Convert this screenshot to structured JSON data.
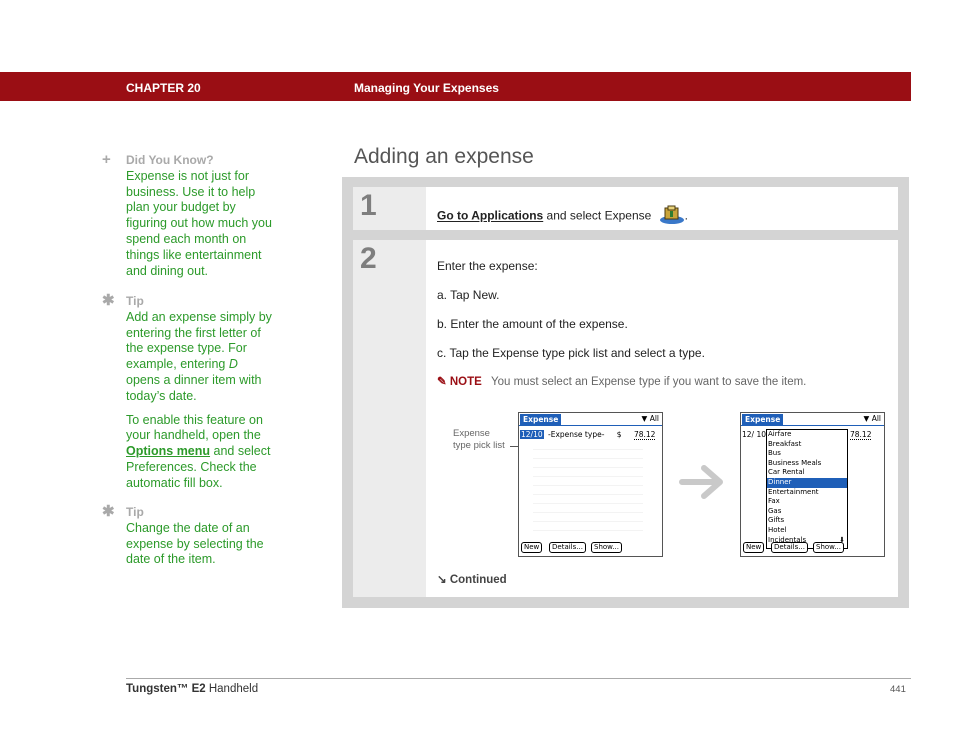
{
  "header": {
    "chapter": "CHAPTER 20",
    "title": "Managing Your Expenses"
  },
  "sidebar": {
    "did_you_know": {
      "heading": "Did You Know?",
      "body": "Expense is not just for business. Use it to help plan your budget by figuring out how much you spend each month on things like entertainment and dining out."
    },
    "tip1": {
      "heading": "Tip",
      "body_a": "Add an expense simply by entering the first letter of the expense type. For example, entering ",
      "body_em": "D",
      "body_b": " opens a dinner item with today’s date.",
      "body2_a": "To enable this feature on your handheld, open the ",
      "body2_link": "Options menu",
      "body2_b": " and select Preferences. Check the automatic fill box."
    },
    "tip2": {
      "heading": "Tip",
      "body": "Change the date of an expense by selecting the date of the item."
    }
  },
  "main": {
    "heading": "Adding an expense",
    "step1": {
      "number": "1",
      "link": "Go to Applications",
      "text": " and select Expense",
      "end": "."
    },
    "step2": {
      "number": "2",
      "intro": "Enter the expense:",
      "a": "a.  Tap New.",
      "b": "b.  Enter the amount of the expense.",
      "c": "c.  Tap the Expense type pick list and select a type.",
      "note_label": "NOTE",
      "note_text": "You must select an Expense type if you want to save the item.",
      "callout_line1": "Expense",
      "callout_line2": "type pick list",
      "continued": "Continued"
    },
    "screen1": {
      "title": "Expense",
      "filter": "All",
      "date": "12/10",
      "type": "-Expense type-",
      "currency": "$",
      "amount": "78.12",
      "btn_new": "New",
      "btn_details": "Details...",
      "btn_show": "Show..."
    },
    "screen2": {
      "title": "Expense",
      "filter": "All",
      "date": "12/ 10",
      "amount": "78.12",
      "btn_new": "New",
      "btn_details": "Details...",
      "btn_show": "Show...",
      "list": [
        "Airfare",
        "Breakfast",
        "Bus",
        "Business Meals",
        "Car Rental",
        "Dinner",
        "Entertainment",
        "Fax",
        "Gas",
        "Gifts",
        "Hotel",
        "Incidentals"
      ],
      "selected": "Dinner"
    }
  },
  "footer": {
    "product_a": "Tungsten™ E2",
    "product_b": " Handheld",
    "page": "441"
  },
  "colors": {
    "bar": "#9a0e14",
    "sidebar_text": "#2c9a2a",
    "palm_blue": "#1f5fb8"
  }
}
